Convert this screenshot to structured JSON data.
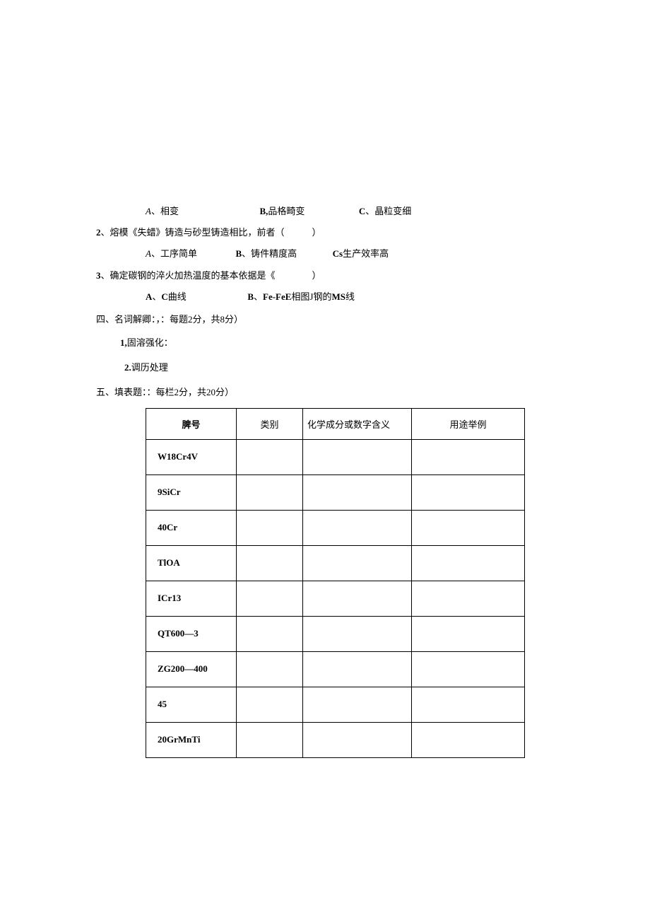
{
  "q1": {
    "opts": {
      "a_label": "A",
      "a_text": "、相变",
      "b_label": "B,",
      "b_text": "品格畸变",
      "c_label": "C",
      "c_text": "、晶粒变细"
    }
  },
  "q2": {
    "num": "2",
    "text": "、熔模《失蜡》铸造与砂型铸造相比，前者（　　　）",
    "opts": {
      "a_label": "A",
      "a_text": "、工序简单",
      "b_label": "B",
      "b_text": "、铸件精度高",
      "c_label": "Cs",
      "c_text": "生产效率高"
    }
  },
  "q3": {
    "num": "3",
    "text": "、确定碳钢的淬火加热温度的基本依据是《　　　　）",
    "opts": {
      "a_label": "A",
      "a_text": "、",
      "a_bold": "C",
      "a_tail": "曲线",
      "b_label": "B",
      "b_text": "、",
      "b_bold": "Fe-FeE",
      "b_mid": "相图J钢的",
      "b_bold2": "MS",
      "b_tail": "线"
    }
  },
  "sec4": {
    "heading": "四、名词解卿：，：每题2分，共8分）",
    "t1_num": "1,",
    "t1_text": "固溶强化：",
    "t2_num": "2.",
    "t2_text": "调历处理"
  },
  "sec5": {
    "heading": "五、填表题：：每栏2分，共20分）",
    "headers": {
      "c1": "脾号",
      "c2": "类别",
      "c3": "化学成分或数字含义",
      "c4": "用途举例"
    },
    "rows": [
      {
        "c1": "W18Cr4V"
      },
      {
        "c1": "9SiCr"
      },
      {
        "c1": "40Cr"
      },
      {
        "c1": "TlOA"
      },
      {
        "c1": "ICr13"
      },
      {
        "c1": "QT600—3"
      },
      {
        "c1": "ZG200—400"
      },
      {
        "c1": "45"
      },
      {
        "c1": "20GrMnTi"
      }
    ]
  }
}
